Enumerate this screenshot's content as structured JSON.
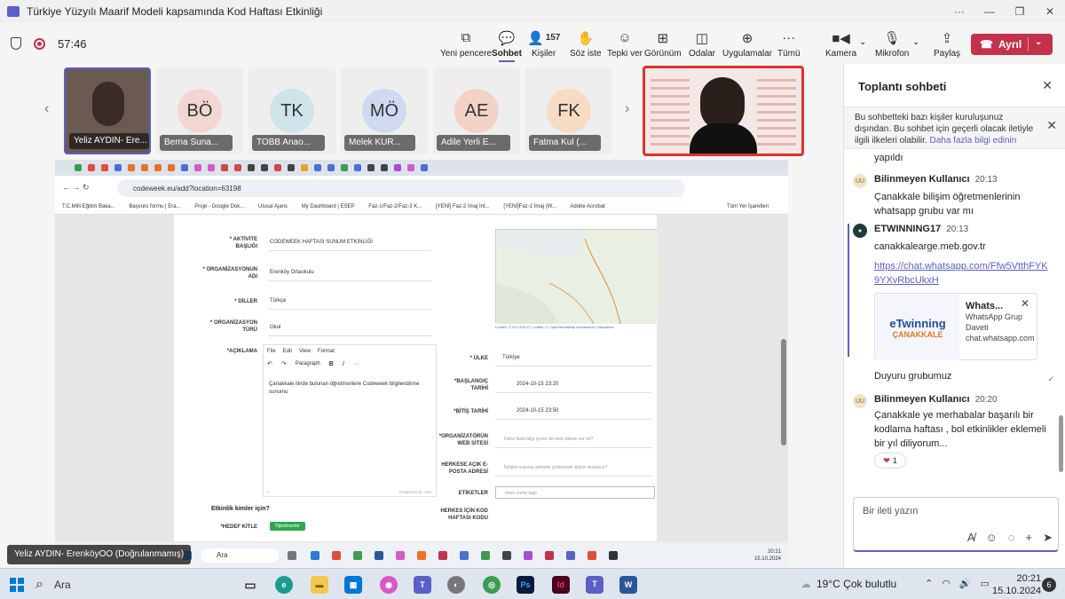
{
  "window": {
    "title": "Türkiye Yüzyılı Maarif Modeli kapsamında Kod Haftası Etkinliği"
  },
  "toolbar": {
    "timer": "57:46",
    "buttons": [
      {
        "label": "Yeni pencere",
        "icon": "popout-icon"
      },
      {
        "label": "Sohbet",
        "icon": "chat-icon",
        "active": true
      },
      {
        "label": "Kişiler",
        "icon": "people-icon",
        "count": "157"
      },
      {
        "label": "Söz iste",
        "icon": "raise-hand-icon"
      },
      {
        "label": "Tepki ver",
        "icon": "emoji-icon"
      },
      {
        "label": "Görünüm",
        "icon": "grid-icon"
      },
      {
        "label": "Odalar",
        "icon": "rooms-icon"
      },
      {
        "label": "Uygulamalar",
        "icon": "add-icon"
      },
      {
        "label": "Tümü",
        "icon": "more-icon"
      },
      {
        "label": "Kamera",
        "icon": "camera-icon"
      },
      {
        "label": "Mikrofon",
        "icon": "mic-icon"
      },
      {
        "label": "Paylaş",
        "icon": "share-icon"
      }
    ],
    "leave_label": "Ayrıl"
  },
  "tiles": [
    {
      "name": "Yeliz AYDIN- Ere...",
      "initials": "",
      "color": "#6b5a52"
    },
    {
      "name": "Berna Suna...",
      "initials": "BÖ",
      "color": "#f2d6d0"
    },
    {
      "name": "TOBB Anao...",
      "initials": "TK",
      "color": "#cfe3ea"
    },
    {
      "name": "Melek KUR...",
      "initials": "MÖ",
      "color": "#cfd9ef"
    },
    {
      "name": "Adile Yerli E...",
      "initials": "AE",
      "color": "#f4d3c7"
    },
    {
      "name": "Fatma Kul (...",
      "initials": "FK",
      "color": "#f6dcc3"
    }
  ],
  "browser": {
    "url": "codeweek.eu/add?location=63198",
    "bookmarks": [
      "T.C.Milli Eğitim Baka...",
      "Başvuru formu | Era...",
      "Proje - Google Dok...",
      "Ulusal Ajans",
      "My Dashboard | ESEP",
      "Faz-1/Faz-2/Faz-3 K...",
      "[YENİ] Faz-2 İmaj İnt...",
      "[YENİ]Faz-1 İmaj (W...",
      "Adobe Acrobat",
      "Tüm Yer İşaretleri"
    ],
    "form": {
      "title_label": "* AKTİVİTE BAŞLIĞI",
      "title_value": "CODEWEEK HAFTASI SUNUM ETKİNLİĞİ",
      "org_label": "* ORGANİZASYONUN ADI",
      "org_value": "Erenköy Ortaokulu",
      "lang_label": "* DİLLER",
      "lang_value": "Türkçe",
      "orgtype_label": "* ORGANİZASYON TÜRÜ",
      "orgtype_value": "Okul",
      "desc_label": "*AÇIKLAMA",
      "editor_menu": [
        "File",
        "Edit",
        "View",
        "Format"
      ],
      "editor_style": "Paragraph",
      "desc_value": "Çanakkale ilinde bulunan öğretmenlere Codeweek bilgilendirme sunumu",
      "editor_p": "P",
      "editor_powered": "POWERED BY TINY",
      "country_label": "* ÜLKE",
      "country_value": "Türkiye",
      "start_label": "*BAŞLANGIÇ TARİHİ",
      "start_value": "2024-10-15 23:20",
      "end_label": "*BİTİŞ TARİHİ",
      "end_value": "2024-10-15 23:50",
      "web_label": "*ORGANİZATÖRÜN WEB SİTESİ",
      "web_placeholder": "Daha fazla bilgi içeren bir web siteniz var mı?",
      "email_label": "HERKESE AÇIK E-POSTA ADRESİ",
      "email_placeholder": "İletişim e-posta adresini göstermek istiyor musunuz?",
      "tags_label": "ETİKETLER",
      "tags_placeholder": "enter some tags",
      "codeweek_label": "HERKES İÇİN KOD HAFTASI KODU",
      "section_title": "Etkinlik kimler için?",
      "target_label": "*HEDEF KİTLE",
      "target_value": "Öğretmenler",
      "map_credit": "Leaflet | © EC-GISCO | Leaflet | © OpenStreetMap contributors | Disclaimer"
    },
    "taskbar_search": "Ara",
    "taskbar_time": "20:21",
    "taskbar_date": "15.10.2024"
  },
  "presenter_label": "Yeliz AYDIN- ErenköyOO (Doğrulanmamış)",
  "chat": {
    "title": "Toplantı sohbeti",
    "notice": "Bu sohbetteki bazı kişiler kuruluşunuz dışından. Bu sohbet için geçerli olacak iletiyle ilgili ilkeleri olabilir.",
    "notice_link": "Daha fazla bilgi edinin",
    "prev_text": "yapıldı",
    "messages": [
      {
        "author": "Bilinmeyen Kullanıcı",
        "time": "20:13",
        "text": "Çanakkale bilişim öğretmenlerinin whatsapp grubu var mı",
        "avatar": "UU"
      },
      {
        "author": "ETWINNING17",
        "time": "20:13",
        "text": "canakkalearge.meb.gov.tr",
        "link": "https://chat.whatsapp.com/Ffw5VtthFYK9YXvRbcUkxH",
        "avatar": ""
      },
      {
        "author": "Bilinmeyen Kullanıcı",
        "time": "20:20",
        "text": "Çanakkale ye merhabalar başarılı bir kodlama haftası , bol etkinlikler eklemeli bir yıl diliyorum...",
        "avatar": "UU"
      }
    ],
    "card": {
      "title": "Whats...",
      "subtitle": "WhatsApp Grup Daveti",
      "domain": "chat.whatsapp.com",
      "img_title": "eTwinning",
      "img_sub": "ÇANAKKALE"
    },
    "after_card": "Duyuru grubumuz",
    "reaction_count": "1",
    "compose_placeholder": "Bir ileti yazın"
  },
  "taskbar": {
    "search": "Ara",
    "weather": "19°C  Çok bulutlu",
    "time": "20:21",
    "date": "15.10.2024"
  }
}
